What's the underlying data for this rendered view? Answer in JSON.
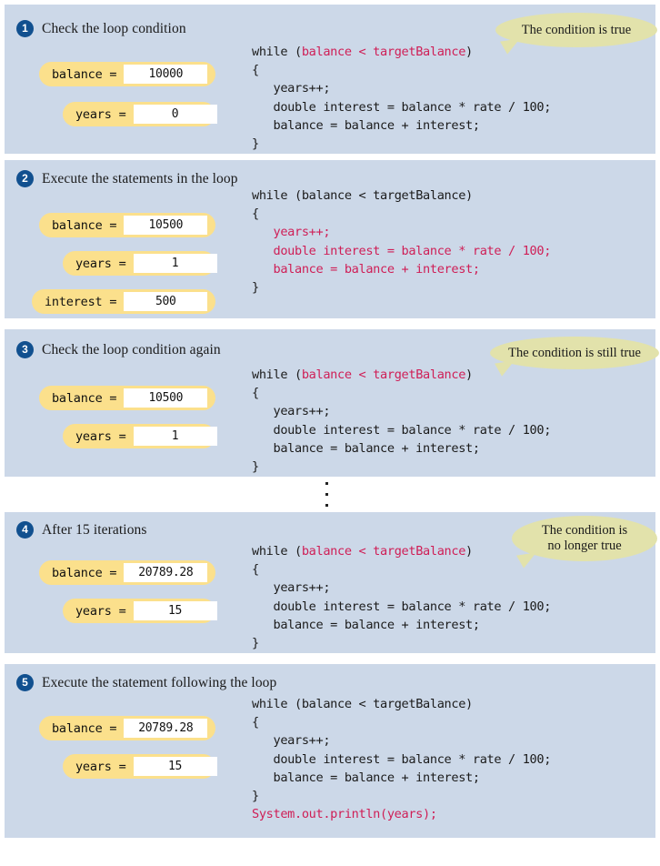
{
  "figure": {
    "code_lines": [
      "while (",
      "balance < targetBalance",
      ")",
      "{",
      "   years++;",
      "   double interest = balance * rate / 100;",
      "   balance = balance + interest;",
      "}",
      "System.out.println(years);"
    ],
    "colors": {
      "panel_bg": "#ccd8e8",
      "pill_bg": "#fbe08c",
      "value_bg": "#ffffff",
      "callout_bg": "#e2e2ab",
      "highlight": "#cf1e56",
      "step_circle": "#11508f",
      "code_text": "#1b1b1b"
    }
  },
  "steps": [
    {
      "number": "1",
      "title": "Check the loop condition",
      "callout": "The condition is true",
      "variables": [
        {
          "label": "balance =",
          "value": "10000"
        },
        {
          "label": "years =",
          "value": "0"
        }
      ],
      "code": {
        "while_kw": "while (",
        "condition": "balance < targetBalance",
        "close_paren": ")",
        "open_brace": "{",
        "body": [
          "   years++;",
          "   double interest = balance * rate / 100;",
          "   balance = balance + interest;"
        ],
        "close_brace": "}",
        "trailing": ""
      }
    },
    {
      "number": "2",
      "title": "Execute the statements in the loop",
      "callout": "",
      "variables": [
        {
          "label": "balance =",
          "value": "10500"
        },
        {
          "label": "years =",
          "value": "1"
        },
        {
          "label": "interest =",
          "value": "500"
        }
      ],
      "code": {
        "while_kw": "while (",
        "condition": "balance < targetBalance",
        "close_paren": ")",
        "open_brace": "{",
        "body": [
          "   years++;",
          "   double interest = balance * rate / 100;",
          "   balance = balance + interest;"
        ],
        "close_brace": "}",
        "trailing": ""
      }
    },
    {
      "number": "3",
      "title": "Check the loop condition again",
      "callout": "The condition is still true",
      "variables": [
        {
          "label": "balance =",
          "value": "10500"
        },
        {
          "label": "years =",
          "value": "1"
        }
      ],
      "code": {
        "while_kw": "while (",
        "condition": "balance < targetBalance",
        "close_paren": ")",
        "open_brace": "{",
        "body": [
          "   years++;",
          "   double interest = balance * rate / 100;",
          "   balance = balance + interest;"
        ],
        "close_brace": "}",
        "trailing": ""
      }
    },
    {
      "number": "4",
      "title": "After 15 iterations",
      "callout": "The condition is\nno longer true",
      "variables": [
        {
          "label": "balance =",
          "value": "20789.28"
        },
        {
          "label": "years =",
          "value": "15"
        }
      ],
      "code": {
        "while_kw": "while (",
        "condition": "balance < targetBalance",
        "close_paren": ")",
        "open_brace": "{",
        "body": [
          "   years++;",
          "   double interest = balance * rate / 100;",
          "   balance = balance + interest;"
        ],
        "close_brace": "}",
        "trailing": ""
      }
    },
    {
      "number": "5",
      "title": "Execute the statement following the loop",
      "callout": "",
      "variables": [
        {
          "label": "balance =",
          "value": "20789.28"
        },
        {
          "label": "years =",
          "value": "15"
        }
      ],
      "code": {
        "while_kw": "while (",
        "condition": "balance < targetBalance",
        "close_paren": ")",
        "open_brace": "{",
        "body": [
          "   years++;",
          "   double interest = balance * rate / 100;",
          "   balance = balance + interest;"
        ],
        "close_brace": "}",
        "trailing": "System.out.println(years);"
      }
    }
  ]
}
